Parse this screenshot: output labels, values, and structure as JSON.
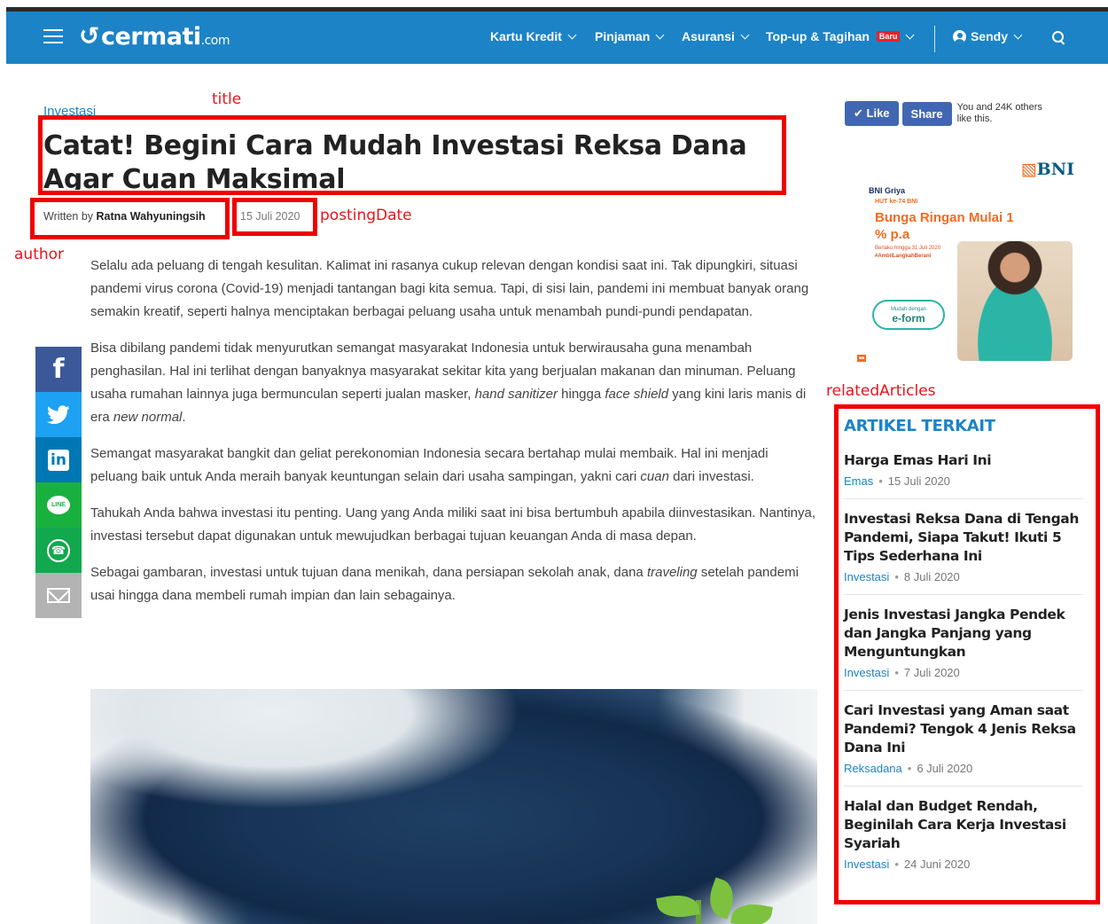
{
  "nav": {
    "logo_text": "cermati",
    "logo_suffix": ".com",
    "menu": [
      {
        "label": "Kartu Kredit"
      },
      {
        "label": "Pinjaman"
      },
      {
        "label": "Asuransi"
      },
      {
        "label": "Top-up & Tagihan",
        "badge": "Baru"
      }
    ],
    "user_label": "Sendy",
    "icons": [
      "hamburger-icon",
      "user-icon",
      "search-icon",
      "chevron-down-icon"
    ]
  },
  "article": {
    "category": "Investasi",
    "title": "Catat! Begini Cara Mudah Investasi Reksa Dana Agar Cuan Maksimal",
    "byline_prefix": "Written by",
    "author": "Ratna Wahyuningsih",
    "date": "15 Juli 2020",
    "paragraphs": [
      [
        "Selalu ada peluang di tengah kesulitan.  Kalimat ini rasanya cukup relevan dengan kondisi saat ini. Tak dipungkiri, situasi pandemi virus corona (Covid-19) menjadi tantangan bagi kita semua. Tapi, di sisi lain, pandemi ini membuat banyak orang semakin kreatif, seperti halnya menciptakan berbagai peluang usaha untuk menambah pundi-pundi pendapatan."
      ],
      [
        "Bisa dibilang pandemi tidak menyurutkan semangat masyarakat Indonesia untuk berwirausaha guna menambah penghasilan. Hal ini terlihat dengan banyaknya masyarakat sekitar kita yang berjualan makanan dan minuman. Peluang usaha rumahan lainnya juga bermunculan seperti jualan masker, ",
        "hand sanitizer",
        " hingga ",
        "face shield",
        " yang kini laris manis di era ",
        "new normal",
        "."
      ],
      [
        "Semangat masyarakat bangkit dan geliat perekonomian Indonesia secara bertahap mulai membaik. Hal ini menjadi peluang baik untuk Anda meraih banyak keuntungan selain dari usaha sampingan, yakni cari ",
        "cuan",
        " dari investasi."
      ],
      [
        "Tahukah Anda bahwa investasi itu penting. Uang yang Anda miliki saat ini bisa bertumbuh apabila diinvestasikan. Nantinya, investasi tersebut dapat digunakan untuk mewujudkan berbagai tujuan keuangan Anda di masa depan."
      ],
      [
        "Sebagai gambaran, investasi untuk tujuan dana menikah, dana persiapan sekolah anak, dana ",
        "traveling",
        " setelah pandemi usai hingga dana membeli rumah impian dan lain sebagainya."
      ]
    ]
  },
  "share": {
    "buttons": [
      "facebook",
      "twitter",
      "linkedin",
      "line",
      "whatsapp",
      "email"
    ],
    "line_label": "LINE",
    "fb_glyph": "f",
    "li_glyph": "in"
  },
  "facebook_widget": {
    "like_label": "Like",
    "share_label": "Share",
    "count_text": "You and 24K others like this."
  },
  "ad": {
    "brand": "BNI",
    "product": "BNI Griya",
    "hut": "HUT ke-74 BNI",
    "headline": "Bunga Ringan Mulai 1 % p.a",
    "validity": "Berlaku hingga 31 Juli 2020",
    "hashtag": "#AmbilLangkahBerani",
    "eform_prefix": "Mudah dengan",
    "eform": "e-form"
  },
  "annotations": {
    "title": "title",
    "author": "author",
    "postingDate": "postingDate",
    "relatedArticles": "relatedArticles"
  },
  "related": {
    "heading": "ARTIKEL TERKAIT",
    "items": [
      {
        "title": "Harga Emas Hari Ini",
        "category": "Emas",
        "date": "15 Juli 2020"
      },
      {
        "title": "Investasi Reksa Dana di Tengah Pandemi, Siapa Takut! Ikuti 5 Tips Sederhana Ini",
        "category": "Investasi",
        "date": "8 Juli 2020"
      },
      {
        "title": "Jenis Investasi Jangka Pendek dan Jangka Panjang yang Menguntungkan",
        "category": "Investasi",
        "date": "7 Juli 2020"
      },
      {
        "title": "Cari Investasi yang Aman saat Pandemi? Tengok 4 Jenis Reksa Dana Ini",
        "category": "Reksadana",
        "date": "6 Juli 2020"
      },
      {
        "title": "Halal dan Budget Rendah, Beginilah Cara Kerja Investasi Syariah",
        "category": "Investasi",
        "date": "24 Juni 2020"
      }
    ]
  },
  "colors": {
    "navbar": "#1c83c6",
    "accent": "#1c83c6",
    "annotation": "#ee0000"
  }
}
